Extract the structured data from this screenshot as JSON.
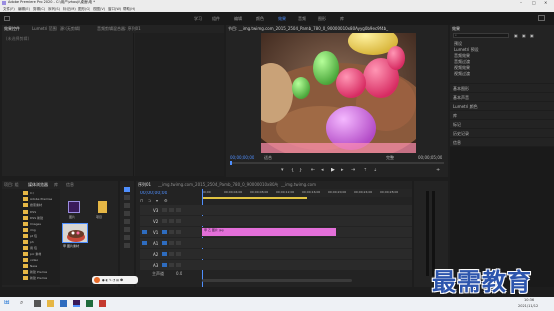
{
  "window": {
    "title": "Adobe Premiere Pro 2020 - C:\\用户\\zhouji\\桌面\\电 *"
  },
  "menu": [
    "文件(F)",
    "编辑(E)",
    "剪辑(C)",
    "序列(S)",
    "标记(M)",
    "图形(G)",
    "视图(V)",
    "窗口(W)",
    "帮助(H)"
  ],
  "workspaces": [
    "学习",
    "组件",
    "编辑",
    "颜色",
    "效果",
    "音频",
    "图形",
    "库"
  ],
  "source_panel": {
    "tabs": [
      "效果控件",
      "Lumetri 范围",
      "源:(无剪辑)",
      "音频剪辑混合器: 序列01"
    ],
    "placeholder": "(未选择剪辑)"
  },
  "program": {
    "title": "节目: __img.twimg.com_2015_2504_Pamb_780_0_90000010x80Ayyg0b9ec9f4b_",
    "timecode_in": "00;00;00;00",
    "fit": "适合",
    "quality": "完整",
    "timecode_out": "00;00;05;00"
  },
  "effects_panel": {
    "title": "效果",
    "items": [
      "预设",
      "Lumetri 预设",
      "音频效果",
      "音频过渡",
      "视频效果",
      "视频过渡"
    ]
  },
  "right_tabs": [
    "基本图形",
    "基本声音",
    "Lumetri 颜色",
    "库",
    "标记",
    "历史记录",
    "信息"
  ],
  "project": {
    "tabs": [
      "项目: 组",
      "媒体浏览器",
      "库",
      "信息"
    ],
    "items": [
      "C:\\",
      "Adobe Premise",
      "搜索素材",
      "DSS",
      "DSS 新建",
      "Images",
      "img",
      "pt 包",
      "ph",
      "用 包",
      "pic 素材",
      "video",
      "Ness",
      "新建 Premie",
      "新建 Premie",
      "Roger",
      "Nacoustic"
    ],
    "thumbs": [
      "图片",
      "项目"
    ],
    "clip_label": "甲 图片素材"
  },
  "timeline": {
    "tab": "序列01",
    "tab2": "__img.twimg.com_2015_2504_Pamb_780_0_90000010x80Ayyg0b9ec9f4b_",
    "tab3": "__img.twimg.com",
    "timecode": "00;00;00;00",
    "tracks": [
      "V3",
      "V2",
      "V1",
      "A1",
      "A2",
      "A3"
    ],
    "master": "主声道",
    "master_val": "0.0",
    "clip_name": "甲 乙 图片 jpg",
    "ruler": [
      "00;00",
      "00;00;04;00",
      "00;00;08;00",
      "00;00;12;00",
      "00;00;16;00",
      "00;00;20;00",
      "00;00;24;00",
      "00;00;28;00",
      "00;00;32;00"
    ]
  },
  "taskbar": {
    "time": "10:36",
    "date": "2021/11/12"
  },
  "watermark": "最需教育"
}
